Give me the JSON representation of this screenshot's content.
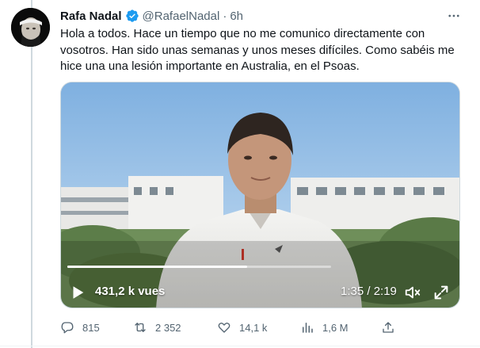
{
  "tweet": {
    "author_name": "Rafa Nadal",
    "handle": "@RafaelNadal",
    "separator": "·",
    "time": "6h",
    "text": "Hola a todos. Hace un tiempo que no me comunico directamente con vosotros. Han sido unas semanas y unos meses difíciles. Como sabéis me hice una una lesión importante en Australia, en el Psoas."
  },
  "video": {
    "views": "431,2 k vues",
    "timecode": "1:35 / 2:19",
    "progress_fraction": 0.683
  },
  "actions": {
    "replies": "815",
    "reposts": "2 352",
    "likes": "14,1 k",
    "views": "1,6 M"
  },
  "colors": {
    "text_primary": "#0f1419",
    "text_secondary": "#536471",
    "verified_blue": "#1d9bf0"
  },
  "icons": {
    "verified": "verified-badge-icon",
    "more": "more-icon",
    "play": "play-icon",
    "volume": "volume-icon",
    "fullscreen": "fullscreen-icon",
    "reply": "reply-icon",
    "repost": "repost-icon",
    "like": "heart-icon",
    "analytics": "analytics-icon",
    "share": "share-icon"
  }
}
